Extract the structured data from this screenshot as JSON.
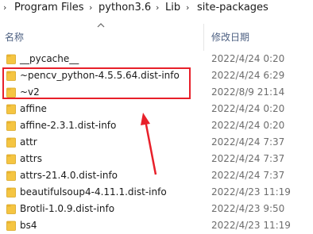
{
  "breadcrumb": [
    "Program Files",
    "python3.6",
    "Lib",
    "site-packages"
  ],
  "columns": {
    "name": "名称",
    "date_modified": "修改日期"
  },
  "files": [
    {
      "name": "__pycache__",
      "date": "2022/4/24 0:20"
    },
    {
      "name": "~pencv_python-4.5.5.64.dist-info",
      "date": "2022/4/24 6:29"
    },
    {
      "name": "~v2",
      "date": "2022/8/9 21:14"
    },
    {
      "name": "affine",
      "date": "2022/4/24 0:20"
    },
    {
      "name": "affine-2.3.1.dist-info",
      "date": "2022/4/24 0:20"
    },
    {
      "name": "attr",
      "date": "2022/4/24 7:37"
    },
    {
      "name": "attrs",
      "date": "2022/4/24 7:37"
    },
    {
      "name": "attrs-21.4.0.dist-info",
      "date": "2022/4/24 7:37"
    },
    {
      "name": "beautifulsoup4-4.11.1.dist-info",
      "date": "2022/4/23 11:19"
    },
    {
      "name": "Brotli-1.0.9.dist-info",
      "date": "2022/4/23 9:50"
    },
    {
      "name": "bs4",
      "date": "2022/4/23 11:19"
    }
  ],
  "colors": {
    "highlight": "#e8202a",
    "folder": "#f5c542",
    "header_text": "#4d6082"
  },
  "icons": {
    "folder": "folder-icon",
    "sort": "sort-up-icon",
    "separator": "chevron-right-icon"
  }
}
